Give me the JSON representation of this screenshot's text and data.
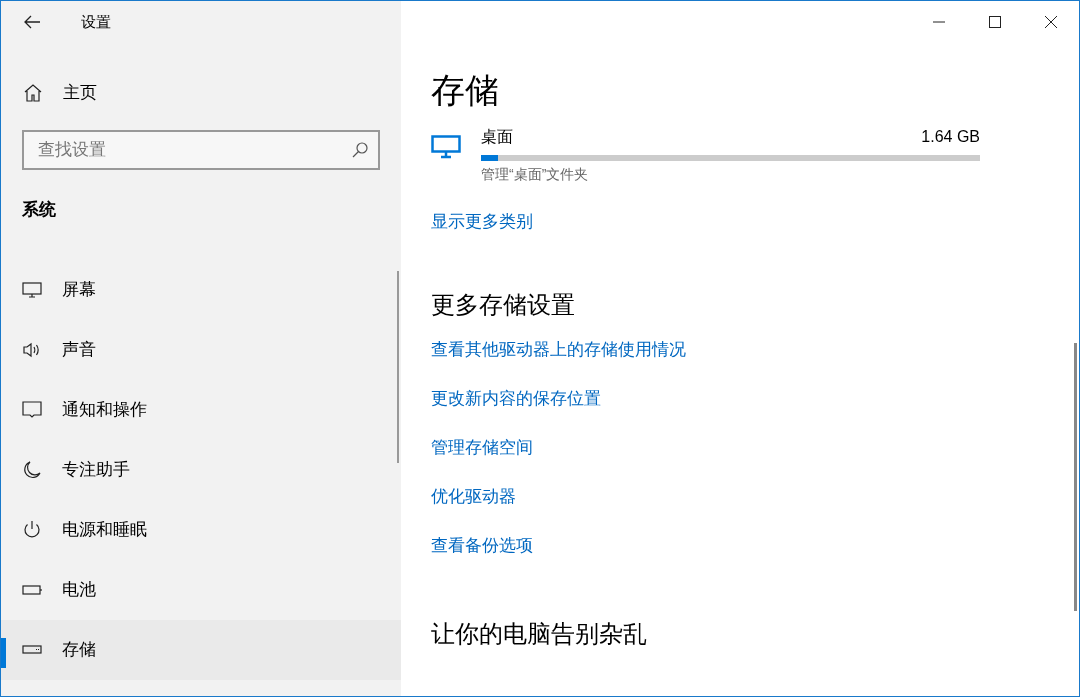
{
  "window": {
    "title": "设置"
  },
  "sidebar": {
    "home": "主页",
    "search": {
      "placeholder": "查找设置"
    },
    "section": "系统",
    "items": [
      {
        "kind": "display",
        "label": "屏幕",
        "selected": false
      },
      {
        "kind": "sound",
        "label": "声音",
        "selected": false
      },
      {
        "kind": "notifications",
        "label": "通知和操作",
        "selected": false
      },
      {
        "kind": "focus",
        "label": "专注助手",
        "selected": false
      },
      {
        "kind": "power",
        "label": "电源和睡眠",
        "selected": false
      },
      {
        "kind": "battery",
        "label": "电池",
        "selected": false
      },
      {
        "kind": "storage",
        "label": "存储",
        "selected": true
      }
    ]
  },
  "content": {
    "title": "存储",
    "category": {
      "name": "桌面",
      "size": "1.64 GB",
      "level": 0.035,
      "description": "管理“桌面”文件夹"
    },
    "more_link": "显示更多类别",
    "more_settings": {
      "heading": "更多存储设置",
      "links": [
        "查看其他驱动器上的存储使用情况",
        "更改新内容的保存位置",
        "管理存储空间",
        "优化驱动器",
        "查看备份选项"
      ]
    },
    "next_heading": "让你的电脑告别杂乱"
  }
}
